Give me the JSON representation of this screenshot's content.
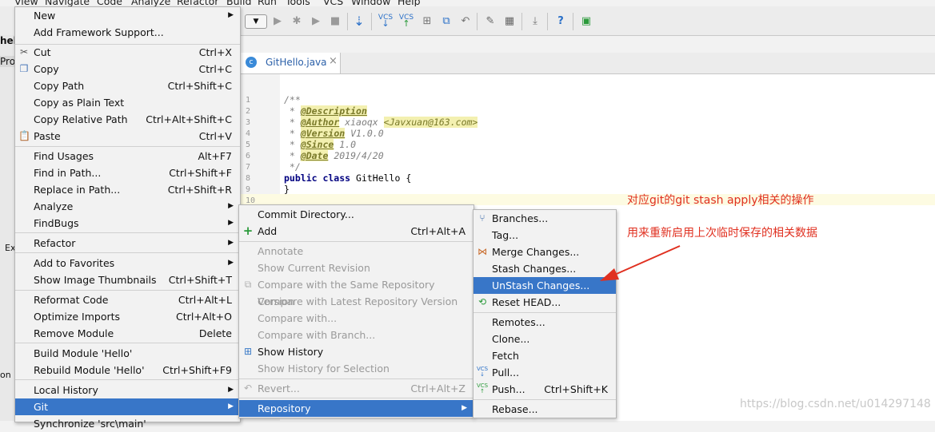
{
  "menubar": {
    "items": [
      "View",
      "Navigate",
      "Code",
      "Analyze",
      "Refactor",
      "Build",
      "Run",
      "Tools",
      "VCS",
      "Window",
      "Help"
    ]
  },
  "tab": {
    "label": "GitHello.java",
    "close": "×"
  },
  "side_fragments": {
    "title": "hell",
    "proj": "Proj",
    "ex": "Ex",
    "on": "on"
  },
  "editor": {
    "line_numbers": [
      "1",
      "2",
      "3",
      "4",
      "5",
      "6",
      "7",
      "8",
      "9",
      "10"
    ],
    "lines": {
      "l1": "/**",
      "l2_star": " * ",
      "l2_tag": "@Description",
      "l3_star": " * ",
      "l3_tag": "@Author",
      "l3_text": " xiaoqx ",
      "l3_email": "<Javxuan@163.com>",
      "l4_star": " * ",
      "l4_tag": "@Version",
      "l4_text": " V1.0.0",
      "l5_star": " * ",
      "l5_tag": "@Since",
      "l5_text": " 1.0",
      "l6_star": " * ",
      "l6_tag": "@Date",
      "l6_text": " 2019/4/20",
      "l7": " */",
      "l8_kw": "public class",
      "l8_text": " GitHello {",
      "l9": "}"
    }
  },
  "context_menu": {
    "items": [
      {
        "label": "New",
        "shortcut": "",
        "submenu": true
      },
      {
        "label": "Add Framework Support...",
        "shortcut": ""
      },
      {
        "label": "Cut",
        "shortcut": "Ctrl+X",
        "icon": "scissors-icon"
      },
      {
        "label": "Copy",
        "shortcut": "Ctrl+C",
        "icon": "copy-icon"
      },
      {
        "label": "Copy Path",
        "shortcut": "Ctrl+Shift+C"
      },
      {
        "label": "Copy as Plain Text",
        "shortcut": ""
      },
      {
        "label": "Copy Relative Path",
        "shortcut": "Ctrl+Alt+Shift+C"
      },
      {
        "label": "Paste",
        "shortcut": "Ctrl+V",
        "icon": "paste-icon"
      },
      {
        "label": "Find Usages",
        "shortcut": "Alt+F7"
      },
      {
        "label": "Find in Path...",
        "shortcut": "Ctrl+Shift+F"
      },
      {
        "label": "Replace in Path...",
        "shortcut": "Ctrl+Shift+R"
      },
      {
        "label": "Analyze",
        "shortcut": "",
        "submenu": true
      },
      {
        "label": "FindBugs",
        "shortcut": "",
        "submenu": true
      },
      {
        "label": "Refactor",
        "shortcut": "",
        "submenu": true
      },
      {
        "label": "Add to Favorites",
        "shortcut": "",
        "submenu": true
      },
      {
        "label": "Show Image Thumbnails",
        "shortcut": "Ctrl+Shift+T"
      },
      {
        "label": "Reformat Code",
        "shortcut": "Ctrl+Alt+L"
      },
      {
        "label": "Optimize Imports",
        "shortcut": "Ctrl+Alt+O"
      },
      {
        "label": "Remove Module",
        "shortcut": "Delete"
      },
      {
        "label": "Build Module 'Hello'",
        "shortcut": ""
      },
      {
        "label": "Rebuild Module 'Hello'",
        "shortcut": "Ctrl+Shift+F9"
      },
      {
        "label": "Local History",
        "shortcut": "",
        "submenu": true
      },
      {
        "label": "Git",
        "shortcut": "",
        "submenu": true,
        "selected": true
      },
      {
        "label": "Synchronize 'src\\main'",
        "shortcut": ""
      }
    ]
  },
  "git_menu": {
    "items": [
      {
        "label": "Commit Directory...",
        "shortcut": ""
      },
      {
        "label": "Add",
        "shortcut": "Ctrl+Alt+A",
        "icon": "plus-icon"
      },
      {
        "label": "Annotate",
        "shortcut": "",
        "disabled": true
      },
      {
        "label": "Show Current Revision",
        "shortcut": "",
        "disabled": true
      },
      {
        "label": "Compare with the Same Repository Version",
        "shortcut": "",
        "disabled": true
      },
      {
        "label": "Compare with Latest Repository Version",
        "shortcut": "",
        "disabled": true
      },
      {
        "label": "Compare with...",
        "shortcut": "",
        "disabled": true
      },
      {
        "label": "Compare with Branch...",
        "shortcut": "",
        "disabled": true
      },
      {
        "label": "Show History",
        "shortcut": "",
        "icon": "history-icon"
      },
      {
        "label": "Show History for Selection",
        "shortcut": "",
        "disabled": true
      },
      {
        "label": "Revert...",
        "shortcut": "Ctrl+Alt+Z",
        "disabled": true,
        "icon": "revert-icon"
      },
      {
        "label": "Repository",
        "shortcut": "",
        "submenu": true,
        "selected": true
      }
    ]
  },
  "repo_menu": {
    "items": [
      {
        "label": "Branches...",
        "icon": "branch-icon"
      },
      {
        "label": "Tag..."
      },
      {
        "label": "Merge Changes...",
        "icon": "merge-icon"
      },
      {
        "label": "Stash Changes..."
      },
      {
        "label": "UnStash Changes...",
        "selected": true
      },
      {
        "label": "Reset HEAD...",
        "icon": "reset-icon"
      },
      {
        "label": "Remotes..."
      },
      {
        "label": "Clone..."
      },
      {
        "label": "Fetch"
      },
      {
        "label": "Pull...",
        "icon": "vcs-pull-icon"
      },
      {
        "label": "Push...",
        "shortcut": "Ctrl+Shift+K",
        "icon": "vcs-push-icon"
      },
      {
        "label": "Rebase..."
      }
    ]
  },
  "annotations": {
    "line1": "对应git的git stash apply相关的操作",
    "line2": "用来重新启用上次临时保存的相关数据",
    "color": "#e03020"
  },
  "watermark": "https://blog.csdn.net/u014297148"
}
